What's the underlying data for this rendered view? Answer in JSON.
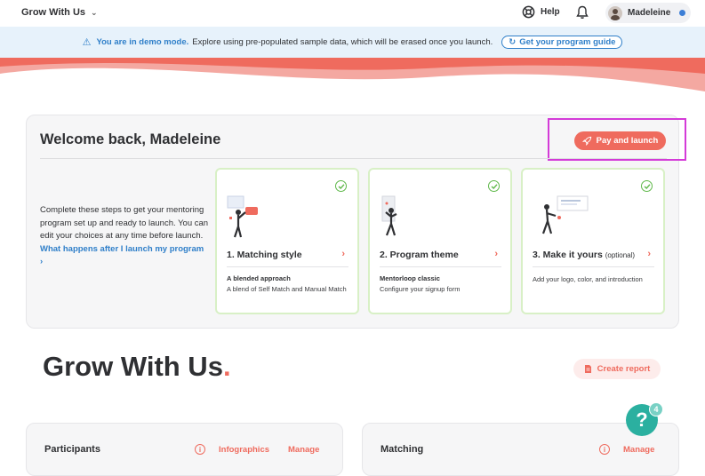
{
  "header": {
    "brand": "Grow With Us",
    "help_label": "Help",
    "user_name": "Madeleine"
  },
  "banner": {
    "demo_label": "You are in demo mode.",
    "message": "Explore using pre-populated sample data, which will be erased once you launch.",
    "guide_label": "Get your program guide"
  },
  "welcome": {
    "title": "Welcome back, Madeleine",
    "launch_label": "Pay and launch",
    "intro": "Complete these steps to get your mentoring program set up and ready to launch. You can edit your choices at any time before launch.",
    "intro_link": "What happens after I launch my program ›",
    "steps": [
      {
        "title": "1. Matching style",
        "subtitle": "A blended approach",
        "description": "A blend of Self Match and Manual Match"
      },
      {
        "title": "2. Program theme",
        "subtitle": "Mentorloop classic",
        "description": "Configure your signup form"
      },
      {
        "title": "3. Make it yours",
        "optional": "(optional)",
        "description": "Add your logo, color, and introduction"
      }
    ]
  },
  "program": {
    "title": "Grow With Us",
    "title_dot": ".",
    "report_label": "Create report"
  },
  "help_fab": {
    "label": "?",
    "badge": "4"
  },
  "panels": {
    "participants": {
      "title": "Participants",
      "infographics": "Infographics",
      "manage": "Manage"
    },
    "matching": {
      "title": "Matching",
      "manage": "Manage"
    }
  },
  "colors": {
    "accent": "#ef6b5e",
    "link": "#2f7fc9",
    "success": "#5fb84a",
    "highlight": "#d43bd8",
    "fab": "#2bb0a0"
  }
}
